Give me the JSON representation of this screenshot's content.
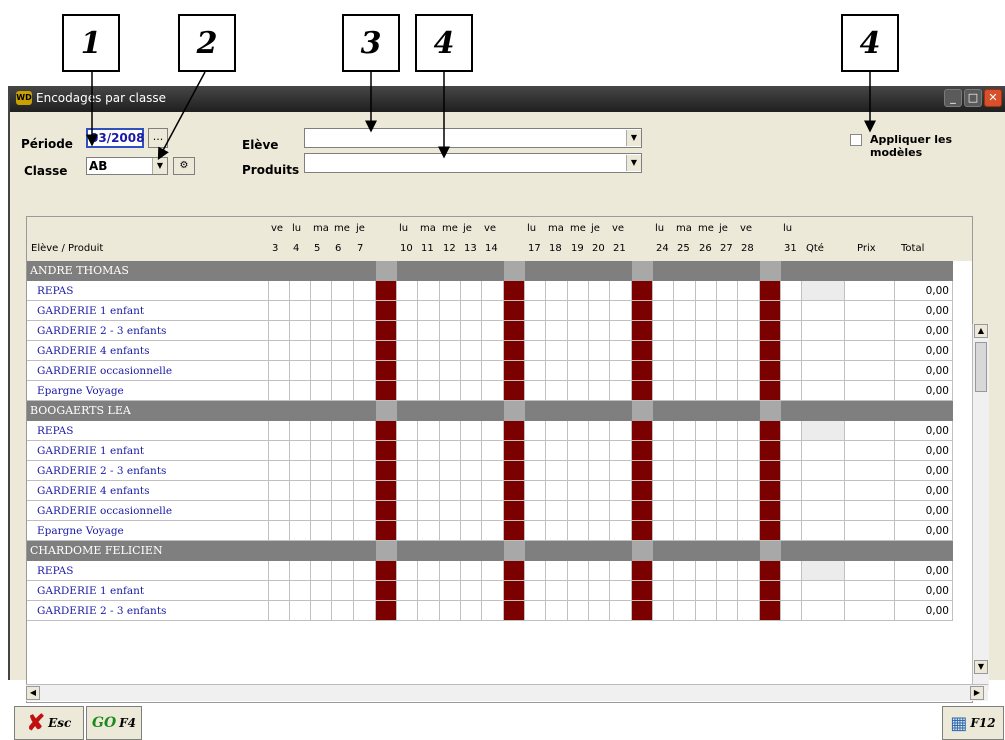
{
  "callouts": [
    "1",
    "2",
    "3",
    "4",
    "4"
  ],
  "window": {
    "title": "Encodages par classe",
    "app_icon": "WD",
    "buttons": [
      "minimize",
      "maximize",
      "close"
    ]
  },
  "filters": {
    "periode_label": "Période",
    "periode_value": "03/2008",
    "periode_btn": "...",
    "classe_label": "Classe",
    "classe_value": "AB",
    "eleve_label": "Elève",
    "eleve_value": "",
    "produits_label": "Produits",
    "produits_value": "",
    "appliquer_label": "Appliquer les modèles",
    "appliquer_checked": false
  },
  "grid": {
    "col_header_label": "Elève / Produit",
    "weekday_labels": [
      "ve",
      "lu",
      "ma",
      "me",
      "je",
      "lu",
      "ma",
      "me",
      "je",
      "ve",
      "lu",
      "ma",
      "me",
      "je",
      "ve",
      "lu",
      "ma",
      "me",
      "je",
      "ve",
      "lu"
    ],
    "day_numbers": [
      "3",
      "4",
      "5",
      "6",
      "7",
      "10",
      "11",
      "12",
      "13",
      "14",
      "17",
      "18",
      "19",
      "20",
      "21",
      "24",
      "25",
      "26",
      "27",
      "28",
      "31"
    ],
    "qte_label": "Qté",
    "prix_label": "Prix",
    "total_label": "Total",
    "highlight_color": "#7b0000",
    "group_color": "#7f7f7f",
    "groups": [
      {
        "name": "ANDRE THOMAS",
        "rows": [
          {
            "product": "REPAS",
            "total": "0,00"
          },
          {
            "product": "GARDERIE 1 enfant",
            "total": "0,00"
          },
          {
            "product": "GARDERIE 2 - 3 enfants",
            "total": "0,00"
          },
          {
            "product": "GARDERIE 4 enfants",
            "total": "0,00"
          },
          {
            "product": "GARDERIE occasionnelle",
            "total": "0,00"
          },
          {
            "product": "Epargne Voyage",
            "total": "0,00"
          }
        ]
      },
      {
        "name": "BOOGAERTS LEA",
        "rows": [
          {
            "product": "REPAS",
            "total": "0,00"
          },
          {
            "product": "GARDERIE 1 enfant",
            "total": "0,00"
          },
          {
            "product": "GARDERIE 2 - 3 enfants",
            "total": "0,00"
          },
          {
            "product": "GARDERIE 4 enfants",
            "total": "0,00"
          },
          {
            "product": "GARDERIE occasionnelle",
            "total": "0,00"
          },
          {
            "product": "Epargne Voyage",
            "total": "0,00"
          }
        ]
      },
      {
        "name": "CHARDOME FELICIEN",
        "rows": [
          {
            "product": "REPAS",
            "total": "0,00"
          },
          {
            "product": "GARDERIE 1 enfant",
            "total": "0,00"
          },
          {
            "product": "GARDERIE 2 - 3 enfants",
            "total": "0,00"
          }
        ]
      }
    ]
  },
  "toolbar": {
    "esc_label": "Esc",
    "go_icon_text": "GO",
    "go_label": "F4",
    "f12_label": "F12"
  }
}
